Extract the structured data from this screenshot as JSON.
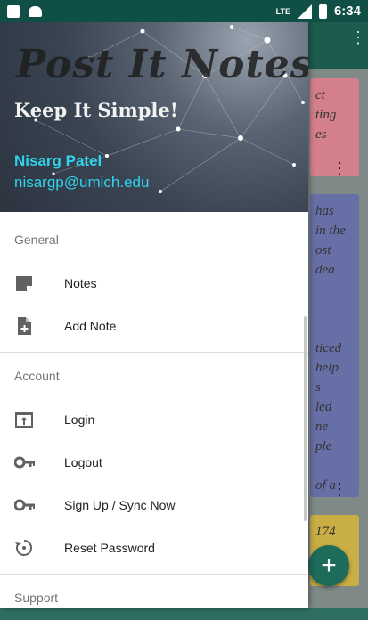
{
  "status_bar": {
    "time": "6:34",
    "network": "LTE"
  },
  "drawer": {
    "header": {
      "title": "Post It Notes",
      "subtitle": "Keep It Simple!",
      "user_name": "Nisarg Patel",
      "user_email": "nisargp@umich.edu"
    },
    "sections": {
      "general": {
        "title": "General",
        "items": [
          {
            "label": "Notes",
            "icon": "note-icon"
          },
          {
            "label": "Add Note",
            "icon": "add-note-icon"
          }
        ]
      },
      "account": {
        "title": "Account",
        "items": [
          {
            "label": "Login",
            "icon": "login-icon"
          },
          {
            "label": "Logout",
            "icon": "key-icon"
          },
          {
            "label": "Sign Up / Sync Now",
            "icon": "key-icon"
          },
          {
            "label": "Reset Password",
            "icon": "reset-icon"
          }
        ]
      },
      "support": {
        "title": "Support"
      }
    }
  },
  "background_notes": {
    "pink": "ct\nting\nes",
    "blue": "has\nin the\nost\ndea\n\n\n\nticed\nhelp\ns\nled\nne\nple\n\nof a\noes\nre",
    "yellow": "174"
  },
  "colors": {
    "accent": "#2fd4ee",
    "primary_dark": "#0f4f45",
    "fab": "#1d6b5a"
  }
}
